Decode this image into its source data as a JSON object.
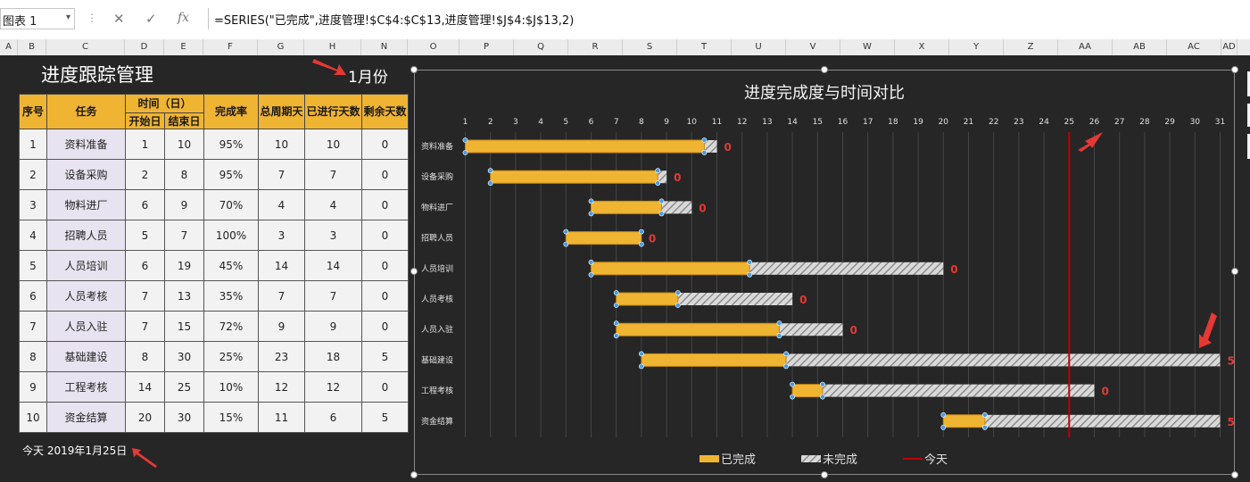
{
  "namebox": {
    "value": "图表 1"
  },
  "formula": {
    "text": "=SERIES(\"已完成\",进度管理!$C$4:$C$13,进度管理!$J$4:$J$13,2)"
  },
  "toolbar": {
    "cancel": "✕",
    "confirm": "✓",
    "fx": "fx"
  },
  "columns": [
    "A",
    "B",
    "C",
    "D",
    "E",
    "F",
    "G",
    "H",
    "N",
    "O",
    "P",
    "Q",
    "R",
    "S",
    "T",
    "U",
    "V",
    "W",
    "X",
    "Y",
    "Z",
    "AA",
    "AB",
    "AC",
    "AD"
  ],
  "sheet": {
    "title": "进度跟踪管理",
    "month": "1月份",
    "today_text": "今天  2019年1月25日"
  },
  "table": {
    "headers": {
      "no": "序号",
      "task": "任务",
      "time": "时间（日）",
      "start": "开始日",
      "end": "结束日",
      "rate": "完成率",
      "total": "总周期天",
      "elapsed": "已进行天数",
      "remain": "剩余天数"
    },
    "rows": [
      {
        "no": "1",
        "task": "资料准备",
        "start": "1",
        "end": "10",
        "rate": "95%",
        "total": "10",
        "elapsed": "10",
        "remain": "0"
      },
      {
        "no": "2",
        "task": "设备采购",
        "start": "2",
        "end": "8",
        "rate": "95%",
        "total": "7",
        "elapsed": "7",
        "remain": "0"
      },
      {
        "no": "3",
        "task": "物料进厂",
        "start": "6",
        "end": "9",
        "rate": "70%",
        "total": "4",
        "elapsed": "4",
        "remain": "0"
      },
      {
        "no": "4",
        "task": "招聘人员",
        "start": "5",
        "end": "7",
        "rate": "100%",
        "total": "3",
        "elapsed": "3",
        "remain": "0"
      },
      {
        "no": "5",
        "task": "人员培训",
        "start": "6",
        "end": "19",
        "rate": "45%",
        "total": "14",
        "elapsed": "14",
        "remain": "0"
      },
      {
        "no": "6",
        "task": "人员考核",
        "start": "7",
        "end": "13",
        "rate": "35%",
        "total": "7",
        "elapsed": "7",
        "remain": "0"
      },
      {
        "no": "7",
        "task": "人员入驻",
        "start": "7",
        "end": "15",
        "rate": "72%",
        "total": "9",
        "elapsed": "9",
        "remain": "0"
      },
      {
        "no": "8",
        "task": "基础建设",
        "start": "8",
        "end": "30",
        "rate": "25%",
        "total": "23",
        "elapsed": "18",
        "remain": "5"
      },
      {
        "no": "9",
        "task": "工程考核",
        "start": "14",
        "end": "25",
        "rate": "10%",
        "total": "12",
        "elapsed": "12",
        "remain": "0"
      },
      {
        "no": "10",
        "task": "资金结算",
        "start": "20",
        "end": "30",
        "rate": "15%",
        "total": "11",
        "elapsed": "6",
        "remain": "5"
      }
    ]
  },
  "chart_data": {
    "type": "bar",
    "title": "进度完成度与时间对比",
    "orientation": "horizontal-gantt",
    "x_ticks": [
      "1",
      "2",
      "3",
      "4",
      "5",
      "6",
      "7",
      "8",
      "9",
      "10",
      "11",
      "12",
      "13",
      "14",
      "15",
      "16",
      "17",
      "18",
      "19",
      "20",
      "21",
      "22",
      "23",
      "24",
      "25",
      "26",
      "27",
      "28",
      "29",
      "30",
      "31"
    ],
    "xlim": [
      1,
      31
    ],
    "today": 25,
    "categories": [
      "资料准备",
      "设备采购",
      "物料进厂",
      "招聘人员",
      "人员培训",
      "人员考核",
      "人员入驻",
      "基础建设",
      "工程考核",
      "资金结算"
    ],
    "series": [
      {
        "name": "已完成",
        "color": "#f0b433"
      },
      {
        "name": "未完成",
        "color": "#bfbfbf"
      },
      {
        "name": "今天",
        "color": "#c00000"
      }
    ],
    "start": [
      1,
      2,
      6,
      5,
      6,
      7,
      7,
      8,
      14,
      20
    ],
    "total_days": [
      10,
      7,
      4,
      3,
      14,
      7,
      9,
      23,
      12,
      11
    ],
    "completion": [
      0.95,
      0.95,
      0.7,
      1.0,
      0.45,
      0.35,
      0.72,
      0.25,
      0.1,
      0.15
    ],
    "remaining_labels": [
      "0",
      "0",
      "0",
      "0",
      "0",
      "0",
      "0",
      "5",
      "0",
      "5"
    ],
    "grid": true,
    "legend": "bottom"
  }
}
